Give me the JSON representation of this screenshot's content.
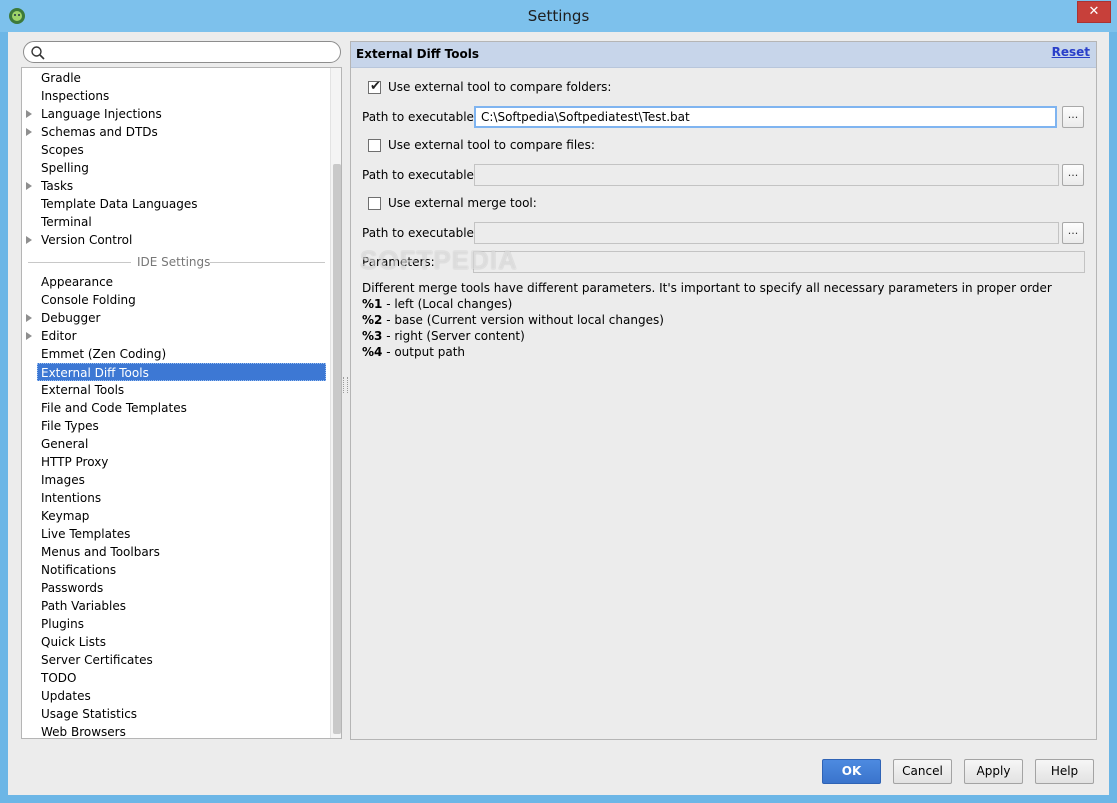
{
  "window": {
    "title": "Settings",
    "close_glyph": "✕"
  },
  "search": {
    "placeholder": "",
    "value": ""
  },
  "tree": {
    "project_items": [
      {
        "label": "Gradle",
        "arrow": false
      },
      {
        "label": "Inspections",
        "arrow": false
      },
      {
        "label": "Language Injections",
        "arrow": true
      },
      {
        "label": "Schemas and DTDs",
        "arrow": true
      },
      {
        "label": "Scopes",
        "arrow": false
      },
      {
        "label": "Spelling",
        "arrow": false
      },
      {
        "label": "Tasks",
        "arrow": true
      },
      {
        "label": "Template Data Languages",
        "arrow": false
      },
      {
        "label": "Terminal",
        "arrow": false
      },
      {
        "label": "Version Control",
        "arrow": true
      }
    ],
    "ide_group_label": "IDE Settings",
    "ide_items": [
      {
        "label": "Appearance",
        "arrow": false
      },
      {
        "label": "Console Folding",
        "arrow": false
      },
      {
        "label": "Debugger",
        "arrow": true
      },
      {
        "label": "Editor",
        "arrow": true
      },
      {
        "label": "Emmet (Zen Coding)",
        "arrow": false
      },
      {
        "label": "External Diff Tools",
        "arrow": false,
        "selected": true
      },
      {
        "label": "External Tools",
        "arrow": false
      },
      {
        "label": "File and Code Templates",
        "arrow": false
      },
      {
        "label": "File Types",
        "arrow": false
      },
      {
        "label": "General",
        "arrow": false
      },
      {
        "label": "HTTP Proxy",
        "arrow": false
      },
      {
        "label": "Images",
        "arrow": false
      },
      {
        "label": "Intentions",
        "arrow": false
      },
      {
        "label": "Keymap",
        "arrow": false
      },
      {
        "label": "Live Templates",
        "arrow": false
      },
      {
        "label": "Menus and Toolbars",
        "arrow": false
      },
      {
        "label": "Notifications",
        "arrow": false
      },
      {
        "label": "Passwords",
        "arrow": false
      },
      {
        "label": "Path Variables",
        "arrow": false
      },
      {
        "label": "Plugins",
        "arrow": false
      },
      {
        "label": "Quick Lists",
        "arrow": false
      },
      {
        "label": "Server Certificates",
        "arrow": false
      },
      {
        "label": "TODO",
        "arrow": false
      },
      {
        "label": "Updates",
        "arrow": false
      },
      {
        "label": "Usage Statistics",
        "arrow": false
      },
      {
        "label": "Web Browsers",
        "arrow": false
      }
    ]
  },
  "panel": {
    "title": "External Diff Tools",
    "reset": "Reset",
    "folders_checkbox": {
      "label": "Use external tool to compare folders:",
      "checked": true
    },
    "folders_path_label": "Path to executable:",
    "folders_path_value": "C:\\Softpedia\\Softpediatest\\Test.bat",
    "files_checkbox": {
      "label": "Use external tool to compare files:",
      "checked": false
    },
    "files_path_label": "Path to executable:",
    "files_path_value": "",
    "merge_checkbox": {
      "label": "Use external merge tool:",
      "checked": false
    },
    "merge_path_label": "Path to executable:",
    "merge_path_value": "",
    "parameters_label": "Parameters:",
    "parameters_value": "",
    "browse_label": "...",
    "description": "Different merge tools have different parameters. It's important to specify all necessary parameters in proper order",
    "params": [
      {
        "key": "%1",
        "text": " - left (Local changes)"
      },
      {
        "key": "%2",
        "text": " - base (Current version without local changes)"
      },
      {
        "key": "%3",
        "text": " - right (Server content)"
      },
      {
        "key": "%4",
        "text": " - output path"
      }
    ],
    "watermark": "SOFTPEDIA"
  },
  "buttons": {
    "ok": "OK",
    "cancel": "Cancel",
    "apply": "Apply",
    "help": "Help"
  },
  "colors": {
    "titlebar": "#7dc1ec",
    "selection": "#3d78d4",
    "header": "#c7d5ea",
    "link": "#2a3fc9"
  }
}
